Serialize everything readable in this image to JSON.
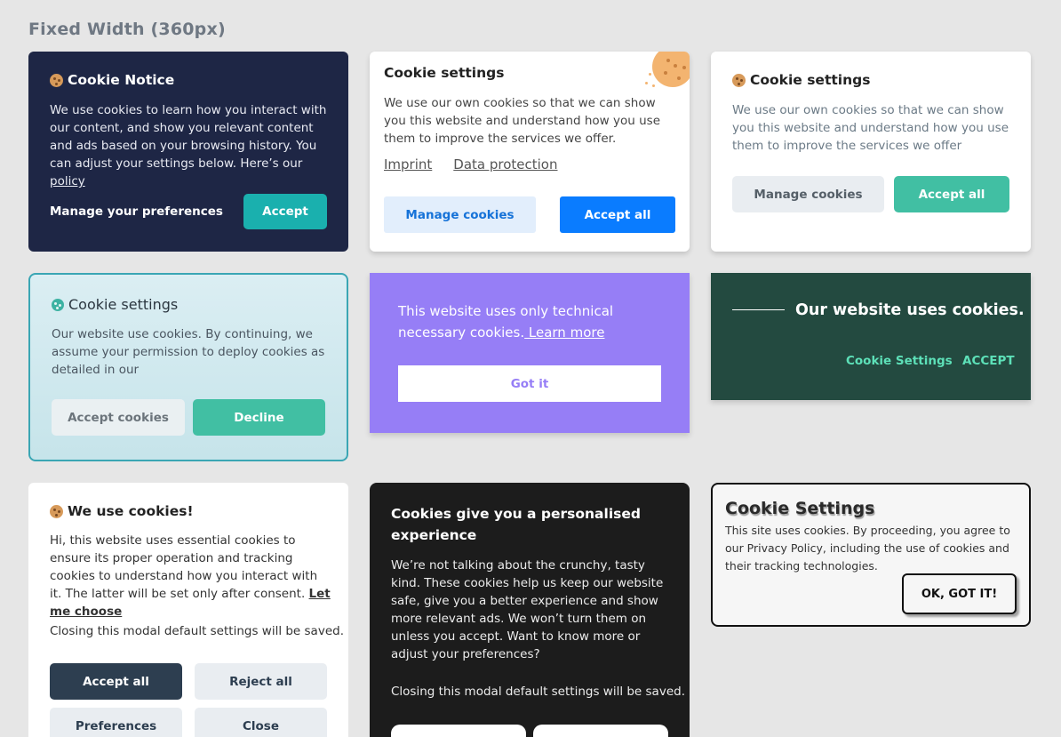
{
  "heading": "Fixed Width (360px)",
  "cards": {
    "c1": {
      "title": "Cookie Notice",
      "body": "We use cookies to learn how you interact with our content, and show you relevant content and ads based on your browsing history. You can adjust your settings below. Here’s our ",
      "link": "policy",
      "pref": "Manage your preferences",
      "accept": "Accept"
    },
    "c2": {
      "title": "Cookie settings",
      "body": "We use our own cookies so that we can show you this website and understand how you use them to improve the services we offer.",
      "link1": "Imprint",
      "link2": "Data protection",
      "manage": "Manage cookies",
      "accept": "Accept all"
    },
    "c3": {
      "title": "Cookie settings",
      "body": "We use our own cookies so that we can show you this website and understand how you use them to improve the services we offer",
      "manage": "Manage cookies",
      "accept": "Accept all"
    },
    "c4": {
      "title": "Cookie settings",
      "body": "Our website use cookies. By continuing, we assume your permission to deploy cookies as detailed in our",
      "accept": "Accept cookies",
      "decline": "Decline"
    },
    "c5": {
      "body": "This website uses only technical necessary cookies.",
      "link": " Learn more",
      "got": "Got it"
    },
    "c6": {
      "title": "Our website uses cookies.",
      "settings": "Cookie Settings",
      "accept": "ACCEPT"
    },
    "c7": {
      "title": "We use cookies!",
      "body": "Hi, this website uses essential cookies to ensure its proper operation and tracking cookies to understand how you interact with it. The latter will be set only after consent. ",
      "link": "Let me choose",
      "note": "Closing this modal default settings will be saved.",
      "accept": "Accept all",
      "reject": "Reject all",
      "prefs": "Preferences",
      "close": "Close"
    },
    "c8": {
      "title": "Cookies give you a personalised experience",
      "body": "We’re not talking about the crunchy, tasty kind. These cookies help us keep our website safe, give you a better experience and show more relevant ads. We won’t turn them on unless you accept. Want to know more or adjust your preferences?",
      "note": "Closing this modal default settings will be saved."
    },
    "c9": {
      "title": "Cookie Settings",
      "body": "This site uses cookies. By proceeding, you agree to our Privacy Policy, including the use of cookies and their tracking technologies.",
      "ok": "OK, GOT IT!"
    }
  }
}
